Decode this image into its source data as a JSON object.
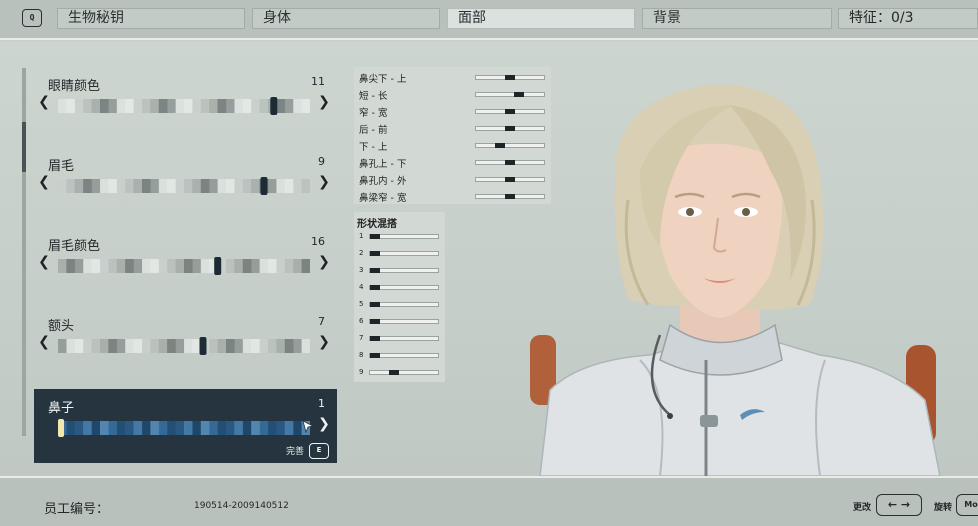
{
  "topbar": {
    "q_key": "Q",
    "tabs": [
      {
        "label": "生物秘钥",
        "active": false
      },
      {
        "label": "身体",
        "active": false
      },
      {
        "label": "面部",
        "active": true
      },
      {
        "label": "背景",
        "active": false
      }
    ],
    "traits": "特征：0/3"
  },
  "sliders": [
    {
      "label": "眼睛颜色",
      "value": "11",
      "position": 0.87,
      "selected": false
    },
    {
      "label": "眉毛",
      "value": "9",
      "position": 0.83,
      "selected": false
    },
    {
      "label": "眉毛颜色",
      "value": "16",
      "position": 0.64,
      "selected": false
    },
    {
      "label": "额头",
      "value": "7",
      "position": 0.58,
      "selected": false
    },
    {
      "label": "鼻子",
      "value": "1",
      "position": 0.0,
      "selected": true
    }
  ],
  "done": {
    "label": "完善",
    "key": "E"
  },
  "nose_params": [
    {
      "label": "鼻尖下 - 上",
      "position": 0.5
    },
    {
      "label": "短 - 长",
      "position": 0.66
    },
    {
      "label": "窄 - 宽",
      "position": 0.5
    },
    {
      "label": "后 - 前",
      "position": 0.5
    },
    {
      "label": "下 - 上",
      "position": 0.33
    },
    {
      "label": "鼻孔上 - 下",
      "position": 0.5
    },
    {
      "label": "鼻孔内 - 外",
      "position": 0.5
    },
    {
      "label": "鼻梁窄 - 宽",
      "position": 0.5
    }
  ],
  "morph": {
    "title": "形状混搭",
    "rows": [
      {
        "n": "1",
        "position": 0.0
      },
      {
        "n": "2",
        "position": 0.0
      },
      {
        "n": "3",
        "position": 0.0
      },
      {
        "n": "4",
        "position": 0.0
      },
      {
        "n": "5",
        "position": 0.0
      },
      {
        "n": "6",
        "position": 0.0
      },
      {
        "n": "7",
        "position": 0.0
      },
      {
        "n": "8",
        "position": 0.0
      },
      {
        "n": "9",
        "position": 0.33
      }
    ]
  },
  "footer": {
    "employee_label": "员工编号：",
    "employee_id": "190514-2009140512",
    "change_label": "更改",
    "change_key": "← →",
    "rotate_label": "旋转",
    "rotate_key": "Mo"
  }
}
